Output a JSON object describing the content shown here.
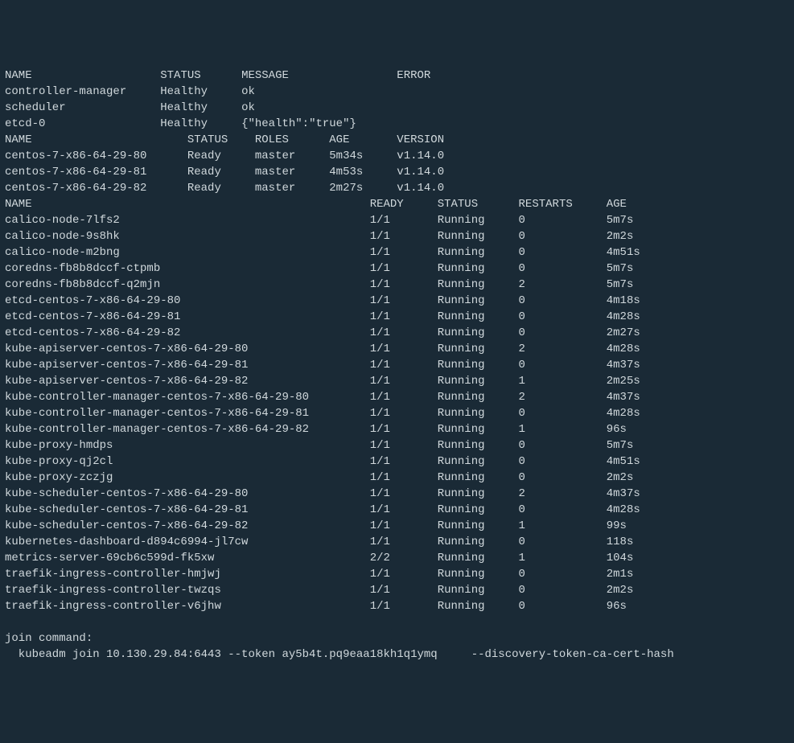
{
  "cs": {
    "headers": [
      "NAME",
      "STATUS",
      "MESSAGE",
      "ERROR"
    ],
    "rows": [
      {
        "name": "controller-manager",
        "status": "Healthy",
        "message": "ok",
        "error": ""
      },
      {
        "name": "scheduler",
        "status": "Healthy",
        "message": "ok",
        "error": ""
      },
      {
        "name": "etcd-0",
        "status": "Healthy",
        "message": "{\"health\":\"true\"}",
        "error": ""
      }
    ]
  },
  "nodes": {
    "headers": [
      "NAME",
      "STATUS",
      "ROLES",
      "AGE",
      "VERSION"
    ],
    "rows": [
      {
        "name": "centos-7-x86-64-29-80",
        "status": "Ready",
        "roles": "master",
        "age": "5m34s",
        "version": "v1.14.0"
      },
      {
        "name": "centos-7-x86-64-29-81",
        "status": "Ready",
        "roles": "master",
        "age": "4m53s",
        "version": "v1.14.0"
      },
      {
        "name": "centos-7-x86-64-29-82",
        "status": "Ready",
        "roles": "master",
        "age": "2m27s",
        "version": "v1.14.0"
      }
    ]
  },
  "pods": {
    "headers": [
      "NAME",
      "READY",
      "STATUS",
      "RESTARTS",
      "AGE"
    ],
    "rows": [
      {
        "name": "calico-node-7lfs2",
        "ready": "1/1",
        "status": "Running",
        "restarts": "0",
        "age": "5m7s"
      },
      {
        "name": "calico-node-9s8hk",
        "ready": "1/1",
        "status": "Running",
        "restarts": "0",
        "age": "2m2s"
      },
      {
        "name": "calico-node-m2bng",
        "ready": "1/1",
        "status": "Running",
        "restarts": "0",
        "age": "4m51s"
      },
      {
        "name": "coredns-fb8b8dccf-ctpmb",
        "ready": "1/1",
        "status": "Running",
        "restarts": "0",
        "age": "5m7s"
      },
      {
        "name": "coredns-fb8b8dccf-q2mjn",
        "ready": "1/1",
        "status": "Running",
        "restarts": "2",
        "age": "5m7s"
      },
      {
        "name": "etcd-centos-7-x86-64-29-80",
        "ready": "1/1",
        "status": "Running",
        "restarts": "0",
        "age": "4m18s"
      },
      {
        "name": "etcd-centos-7-x86-64-29-81",
        "ready": "1/1",
        "status": "Running",
        "restarts": "0",
        "age": "4m28s"
      },
      {
        "name": "etcd-centos-7-x86-64-29-82",
        "ready": "1/1",
        "status": "Running",
        "restarts": "0",
        "age": "2m27s"
      },
      {
        "name": "kube-apiserver-centos-7-x86-64-29-80",
        "ready": "1/1",
        "status": "Running",
        "restarts": "2",
        "age": "4m28s"
      },
      {
        "name": "kube-apiserver-centos-7-x86-64-29-81",
        "ready": "1/1",
        "status": "Running",
        "restarts": "0",
        "age": "4m37s"
      },
      {
        "name": "kube-apiserver-centos-7-x86-64-29-82",
        "ready": "1/1",
        "status": "Running",
        "restarts": "1",
        "age": "2m25s"
      },
      {
        "name": "kube-controller-manager-centos-7-x86-64-29-80",
        "ready": "1/1",
        "status": "Running",
        "restarts": "2",
        "age": "4m37s"
      },
      {
        "name": "kube-controller-manager-centos-7-x86-64-29-81",
        "ready": "1/1",
        "status": "Running",
        "restarts": "0",
        "age": "4m28s"
      },
      {
        "name": "kube-controller-manager-centos-7-x86-64-29-82",
        "ready": "1/1",
        "status": "Running",
        "restarts": "1",
        "age": "96s"
      },
      {
        "name": "kube-proxy-hmdps",
        "ready": "1/1",
        "status": "Running",
        "restarts": "0",
        "age": "5m7s"
      },
      {
        "name": "kube-proxy-qj2cl",
        "ready": "1/1",
        "status": "Running",
        "restarts": "0",
        "age": "4m51s"
      },
      {
        "name": "kube-proxy-zczjg",
        "ready": "1/1",
        "status": "Running",
        "restarts": "0",
        "age": "2m2s"
      },
      {
        "name": "kube-scheduler-centos-7-x86-64-29-80",
        "ready": "1/1",
        "status": "Running",
        "restarts": "2",
        "age": "4m37s"
      },
      {
        "name": "kube-scheduler-centos-7-x86-64-29-81",
        "ready": "1/1",
        "status": "Running",
        "restarts": "0",
        "age": "4m28s"
      },
      {
        "name": "kube-scheduler-centos-7-x86-64-29-82",
        "ready": "1/1",
        "status": "Running",
        "restarts": "1",
        "age": "99s"
      },
      {
        "name": "kubernetes-dashboard-d894c6994-jl7cw",
        "ready": "1/1",
        "status": "Running",
        "restarts": "0",
        "age": "118s"
      },
      {
        "name": "metrics-server-69cb6c599d-fk5xw",
        "ready": "2/2",
        "status": "Running",
        "restarts": "1",
        "age": "104s"
      },
      {
        "name": "traefik-ingress-controller-hmjwj",
        "ready": "1/1",
        "status": "Running",
        "restarts": "0",
        "age": "2m1s"
      },
      {
        "name": "traefik-ingress-controller-twzqs",
        "ready": "1/1",
        "status": "Running",
        "restarts": "0",
        "age": "2m2s"
      },
      {
        "name": "traefik-ingress-controller-v6jhw",
        "ready": "1/1",
        "status": "Running",
        "restarts": "0",
        "age": "96s"
      }
    ]
  },
  "join": {
    "label": "join command:",
    "cmd": "  kubeadm join 10.130.29.84:6443 --token ay5b4t.pq9eaa18kh1q1ymq     --discovery-token-ca-cert-hash"
  },
  "widths": {
    "cs": {
      "name": 23,
      "status": 12,
      "message": 23,
      "error": 10
    },
    "nodes": {
      "name": 27,
      "status": 10,
      "roles": 11,
      "age": 10,
      "version": 10
    },
    "pods": {
      "name": 54,
      "ready": 10,
      "status": 12,
      "restarts": 13,
      "age": 10
    }
  }
}
